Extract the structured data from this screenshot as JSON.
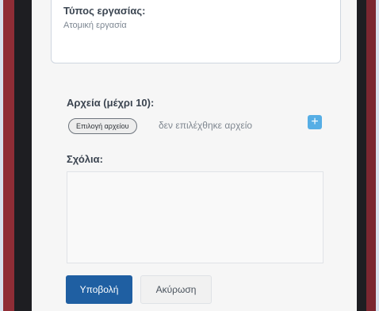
{
  "task_type": {
    "label": "Τύπος εργασίας:",
    "value": "Ατομική εργασία"
  },
  "files": {
    "label": "Αρχεία (μέχρι 10):",
    "choose_button": "Επιλογή αρχείου",
    "status": "δεν επιλέχθηκε αρχείο",
    "add_icon": "+"
  },
  "comments": {
    "label": "Σχόλια:",
    "value": ""
  },
  "actions": {
    "submit": "Υποβολή",
    "cancel": "Ακύρωση"
  },
  "colors": {
    "background": "#d7e1ee",
    "primary_button": "#1f5fa2",
    "add_button": "#56aee5"
  }
}
